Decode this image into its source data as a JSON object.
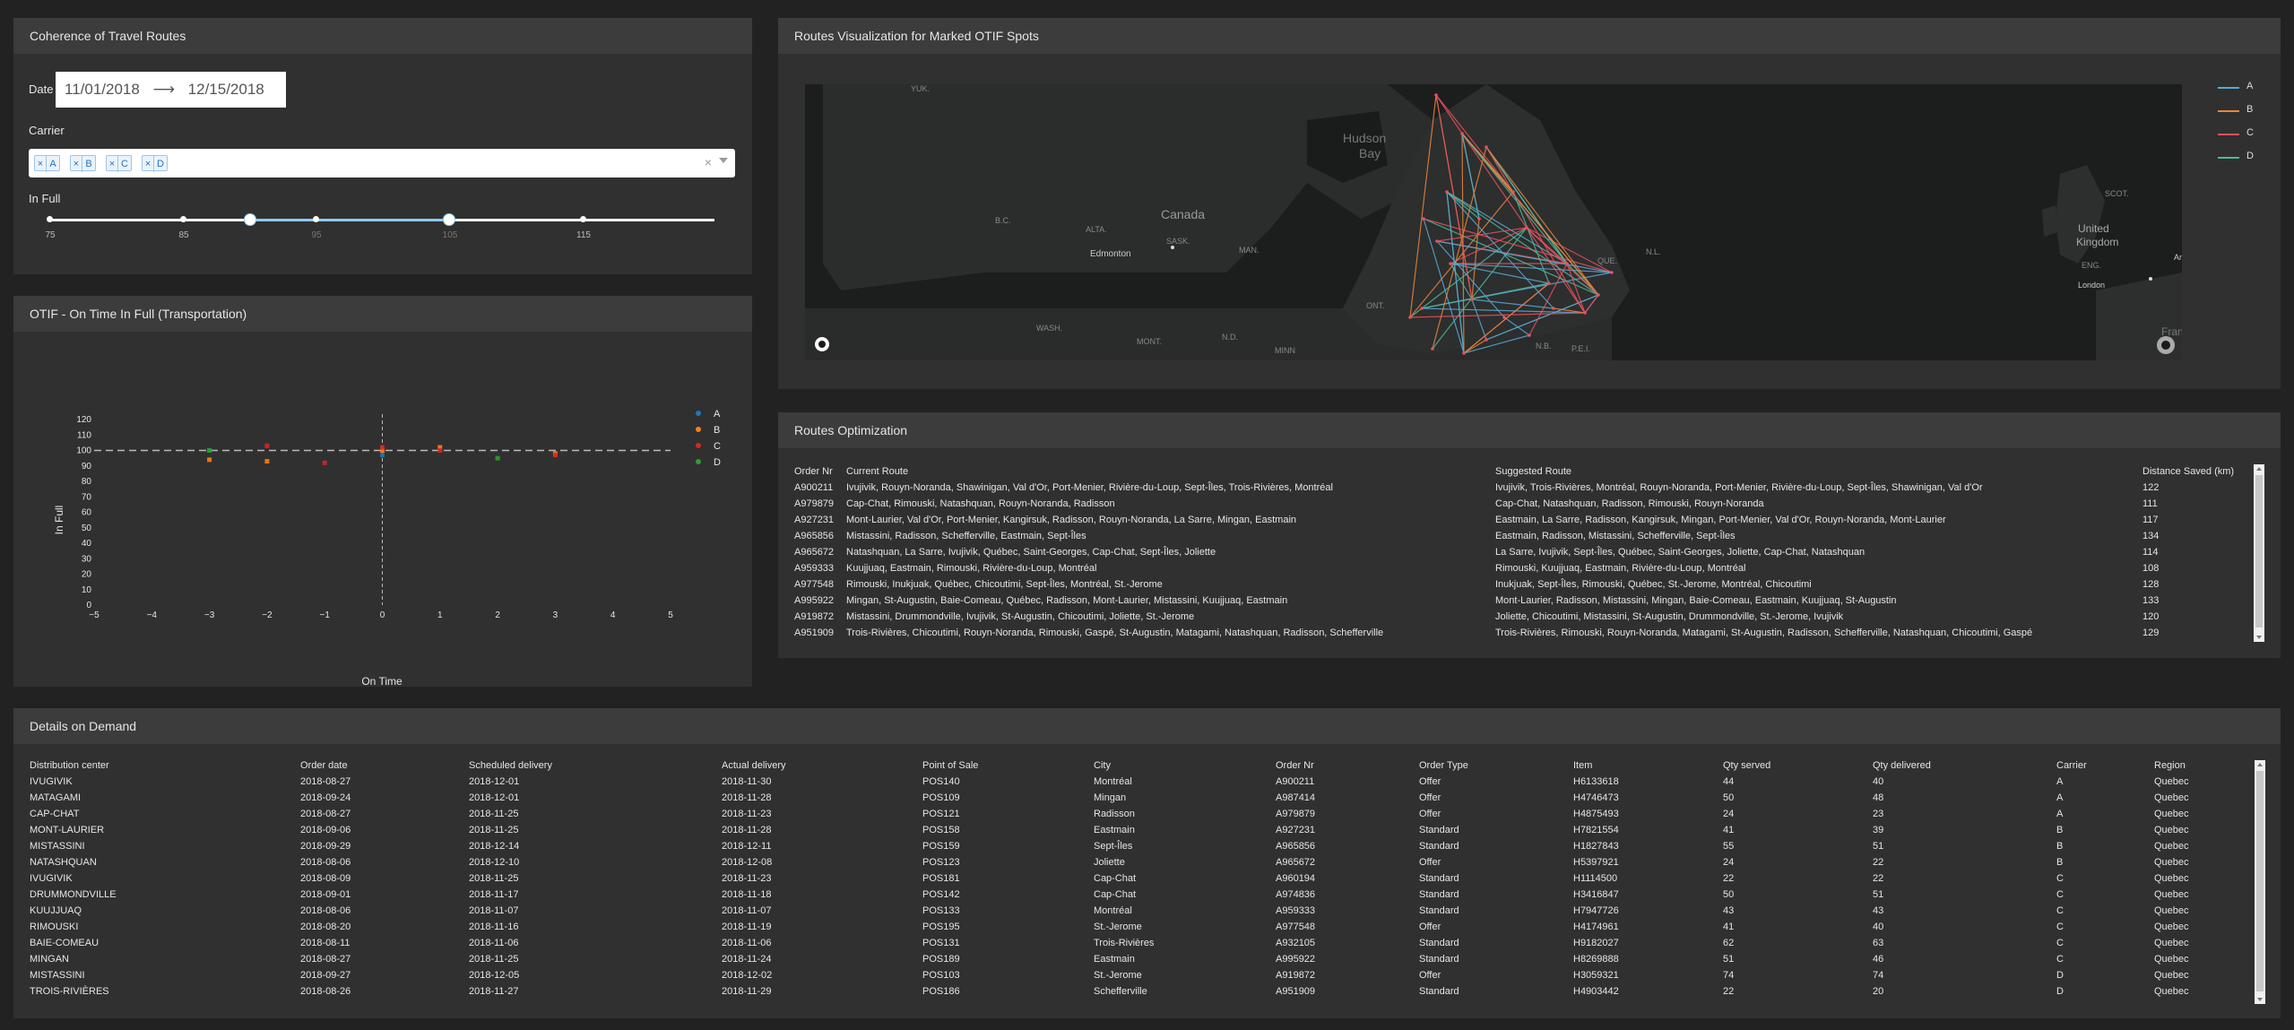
{
  "coherence": {
    "title": "Coherence of Travel Routes",
    "date_label": "Date",
    "date_start": "11/01/2018",
    "date_arrow": "⟶",
    "date_end": "12/15/2018",
    "carrier_label": "Carrier",
    "carriers_selected": [
      "A",
      "B",
      "C",
      "D"
    ],
    "chip_remove": "×",
    "clear_all": "×",
    "infull_label": "In Full",
    "slider_marks": [
      "75",
      "85",
      "95",
      "105",
      "115"
    ],
    "slider_range": [
      90,
      105
    ],
    "slider_min": 75,
    "slider_max": 125
  },
  "otif": {
    "title": "OTIF - On Time In Full (Transportation)",
    "chart_data": {
      "type": "scatter",
      "xlabel": "On Time",
      "ylabel": "In Full",
      "xlim": [
        -5,
        5
      ],
      "ylim": [
        0,
        120
      ],
      "x_ticks": [
        "−5",
        "−4",
        "−3",
        "−2",
        "−1",
        "0",
        "1",
        "2",
        "3",
        "4",
        "5"
      ],
      "y_ticks": [
        "0",
        "10",
        "20",
        "30",
        "40",
        "50",
        "60",
        "70",
        "80",
        "90",
        "100",
        "110",
        "120"
      ],
      "reference_line_y": 100,
      "reference_line_x": 0,
      "series": [
        {
          "name": "A",
          "color": "#1f77b4",
          "points": [
            [
              -3,
              100
            ],
            [
              0,
              97
            ]
          ]
        },
        {
          "name": "B",
          "color": "#ff7f0e",
          "points": [
            [
              -3,
              94
            ],
            [
              -2,
              93
            ],
            [
              1,
              102
            ],
            [
              3,
              98
            ],
            [
              0,
              100
            ]
          ]
        },
        {
          "name": "C",
          "color": "#d62728",
          "points": [
            [
              -2,
              103
            ],
            [
              -1,
              92
            ],
            [
              0,
              102
            ],
            [
              1,
              100
            ],
            [
              3,
              97
            ]
          ]
        },
        {
          "name": "D",
          "color": "#2ca02c",
          "points": [
            [
              -3,
              100
            ],
            [
              2,
              95
            ]
          ]
        }
      ]
    }
  },
  "map": {
    "title": "Routes Visualization for Marked OTIF Spots",
    "legend": [
      {
        "name": "A",
        "color": "#5aa9d6"
      },
      {
        "name": "B",
        "color": "#e8863c"
      },
      {
        "name": "C",
        "color": "#e8525b"
      },
      {
        "name": "D",
        "color": "#4fb99a"
      }
    ],
    "labels": [
      "YUK.",
      "Hudson",
      "Bay",
      "B.C.",
      "ALTA.",
      "Canada",
      "SASK.",
      "MAN.",
      "Edmonton",
      "ONT.",
      "WASH.",
      "MONT.",
      "N.D.",
      "MINN",
      "QUE.",
      "N.L.",
      "P.E.I.",
      "N.B.",
      "SCOT.",
      "United",
      "Kingdom",
      "ENG.",
      "London",
      "Ar",
      "Fran"
    ]
  },
  "routes_opt": {
    "title": "Routes Optimization",
    "columns": [
      "Order Nr",
      "Current Route",
      "Suggested Route",
      "Distance Saved (km)"
    ],
    "rows": [
      [
        "A900211",
        "Ivujivik, Rouyn-Noranda, Shawinigan, Val d'Or, Port-Menier, Rivière-du-Loup, Sept-Îles, Trois-Rivières, Montréal",
        "Ivujivik, Trois-Rivières, Montréal, Rouyn-Noranda, Port-Menier, Rivière-du-Loup, Sept-Îles, Shawinigan, Val d'Or",
        "122"
      ],
      [
        "A979879",
        "Cap-Chat, Rimouski, Natashquan, Rouyn-Noranda, Radisson",
        "Cap-Chat, Natashquan, Radisson, Rimouski, Rouyn-Noranda",
        "111"
      ],
      [
        "A927231",
        "Mont-Laurier, Val d'Or, Port-Menier, Kangirsuk, Radisson, Rouyn-Noranda, La Sarre, Mingan, Eastmain",
        "Eastmain, La Sarre, Radisson, Kangirsuk, Mingan, Port-Menier, Val d'Or, Rouyn-Noranda, Mont-Laurier",
        "117"
      ],
      [
        "A965856",
        "Mistassini, Radisson, Schefferville, Eastmain, Sept-Îles",
        "Eastmain, Radisson, Mistassini, Schefferville, Sept-Îles",
        "134"
      ],
      [
        "A965672",
        "Natashquan, La Sarre, Ivujivik, Québec, Saint-Georges, Cap-Chat, Sept-Îles, Joliette",
        "La Sarre, Ivujivik, Sept-Îles, Québec, Saint-Georges, Joliette, Cap-Chat, Natashquan",
        "114"
      ],
      [
        "A959333",
        "Kuujjuaq, Eastmain, Rimouski, Rivière-du-Loup, Montréal",
        "Rimouski, Kuujjuaq, Eastmain, Rivière-du-Loup, Montréal",
        "108"
      ],
      [
        "A977548",
        "Rimouski, Inukjuak, Québec, Chicoutimi, Sept-Îles, Montréal, St.-Jerome",
        "Inukjuak, Sept-Îles, Rimouski, Québec, St.-Jerome, Montréal, Chicoutimi",
        "128"
      ],
      [
        "A995922",
        "Mingan, St-Augustin, Baie-Comeau, Québec, Radisson, Mont-Laurier, Mistassini, Kuujjuaq, Eastmain",
        "Mont-Laurier, Radisson, Mistassini, Mingan, Baie-Comeau, Eastmain, Kuujjuaq, St-Augustin",
        "133"
      ],
      [
        "A919872",
        "Mistassini, Drummondville, Ivujivik, St-Augustin, Chicoutimi, Joliette, St.-Jerome",
        "Joliette, Chicoutimi, Mistassini, St-Augustin, Drummondville, St.-Jerome, Ivujivik",
        "120"
      ],
      [
        "A951909",
        "Trois-Rivières, Chicoutimi, Rouyn-Noranda, Rimouski, Gaspé, St-Augustin, Matagami, Natashquan, Radisson, Schefferville",
        "Trois-Rivières, Rimouski, Rouyn-Noranda, Matagami, St-Augustin, Radisson, Schefferville, Natashquan, Chicoutimi, Gaspé",
        "129"
      ]
    ]
  },
  "details": {
    "title": "Details on Demand",
    "columns": [
      "Distribution center",
      "Order date",
      "Scheduled delivery",
      "Actual delivery",
      "Point of Sale",
      "City",
      "Order Nr",
      "Order Type",
      "Item",
      "Qty served",
      "Qty delivered",
      "Carrier",
      "Region"
    ],
    "rows": [
      [
        "IVUGIVIK",
        "2018-08-27",
        "2018-12-01",
        "2018-11-30",
        "POS140",
        "Montréal",
        "A900211",
        "Offer",
        "H6133618",
        "44",
        "40",
        "A",
        "Quebec"
      ],
      [
        "MATAGAMI",
        "2018-09-24",
        "2018-12-01",
        "2018-11-28",
        "POS109",
        "Mingan",
        "A987414",
        "Offer",
        "H4746473",
        "50",
        "48",
        "A",
        "Quebec"
      ],
      [
        "CAP-CHAT",
        "2018-08-27",
        "2018-11-25",
        "2018-11-23",
        "POS121",
        "Radisson",
        "A979879",
        "Offer",
        "H4875493",
        "24",
        "23",
        "A",
        "Quebec"
      ],
      [
        "MONT-LAURIER",
        "2018-09-06",
        "2018-11-25",
        "2018-11-28",
        "POS158",
        "Eastmain",
        "A927231",
        "Standard",
        "H7821554",
        "41",
        "39",
        "B",
        "Quebec"
      ],
      [
        "MISTASSINI",
        "2018-09-29",
        "2018-12-14",
        "2018-12-11",
        "POS159",
        "Sept-Îles",
        "A965856",
        "Standard",
        "H1827843",
        "55",
        "51",
        "B",
        "Quebec"
      ],
      [
        "NATASHQUAN",
        "2018-08-06",
        "2018-12-10",
        "2018-12-08",
        "POS123",
        "Joliette",
        "A965672",
        "Offer",
        "H5397921",
        "24",
        "22",
        "B",
        "Quebec"
      ],
      [
        "IVUGIVIK",
        "2018-08-09",
        "2018-11-25",
        "2018-11-23",
        "POS181",
        "Cap-Chat",
        "A960194",
        "Standard",
        "H1114500",
        "22",
        "22",
        "C",
        "Quebec"
      ],
      [
        "DRUMMONDVILLE",
        "2018-09-01",
        "2018-11-17",
        "2018-11-18",
        "POS142",
        "Cap-Chat",
        "A974836",
        "Standard",
        "H3416847",
        "50",
        "51",
        "C",
        "Quebec"
      ],
      [
        "KUUJJUAQ",
        "2018-08-06",
        "2018-11-07",
        "2018-11-07",
        "POS133",
        "Montréal",
        "A959333",
        "Standard",
        "H7947726",
        "43",
        "43",
        "C",
        "Quebec"
      ],
      [
        "RIMOUSKI",
        "2018-08-20",
        "2018-11-16",
        "2018-11-19",
        "POS195",
        "St.-Jerome",
        "A977548",
        "Offer",
        "H4174961",
        "41",
        "40",
        "C",
        "Quebec"
      ],
      [
        "BAIE-COMEAU",
        "2018-08-11",
        "2018-11-06",
        "2018-11-06",
        "POS131",
        "Trois-Rivières",
        "A932105",
        "Standard",
        "H9182027",
        "62",
        "63",
        "C",
        "Quebec"
      ],
      [
        "MINGAN",
        "2018-08-27",
        "2018-11-25",
        "2018-11-24",
        "POS189",
        "Eastmain",
        "A995922",
        "Standard",
        "H8269888",
        "51",
        "46",
        "C",
        "Quebec"
      ],
      [
        "MISTASSINI",
        "2018-09-27",
        "2018-12-05",
        "2018-12-02",
        "POS103",
        "St.-Jerome",
        "A919872",
        "Offer",
        "H3059321",
        "74",
        "74",
        "D",
        "Quebec"
      ],
      [
        "TROIS-RIVIÈRES",
        "2018-08-26",
        "2018-11-27",
        "2018-11-29",
        "POS186",
        "Schefferville",
        "A951909",
        "Standard",
        "H4903442",
        "22",
        "20",
        "D",
        "Quebec"
      ]
    ]
  }
}
